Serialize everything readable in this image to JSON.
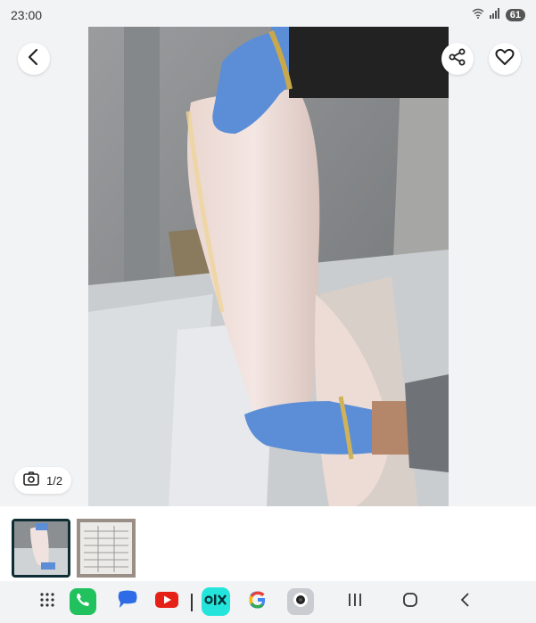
{
  "status_bar": {
    "time": "23:00",
    "battery": "61"
  },
  "photo": {
    "counter": "1/2"
  },
  "icons": {
    "back": "chevron-left-icon",
    "share": "share-icon",
    "favorite": "heart-icon",
    "camera": "camera-icon"
  },
  "navbar": {
    "apps": [
      "app-drawer",
      "phone",
      "messages",
      "youtube",
      "olx",
      "google",
      "camera"
    ],
    "buttons": [
      "recent-apps",
      "home",
      "back"
    ]
  },
  "colors": {
    "glove": "#5b8ed6",
    "accent_olx": "#23e5db",
    "phone": "#21c25e",
    "youtube": "#e62117"
  }
}
